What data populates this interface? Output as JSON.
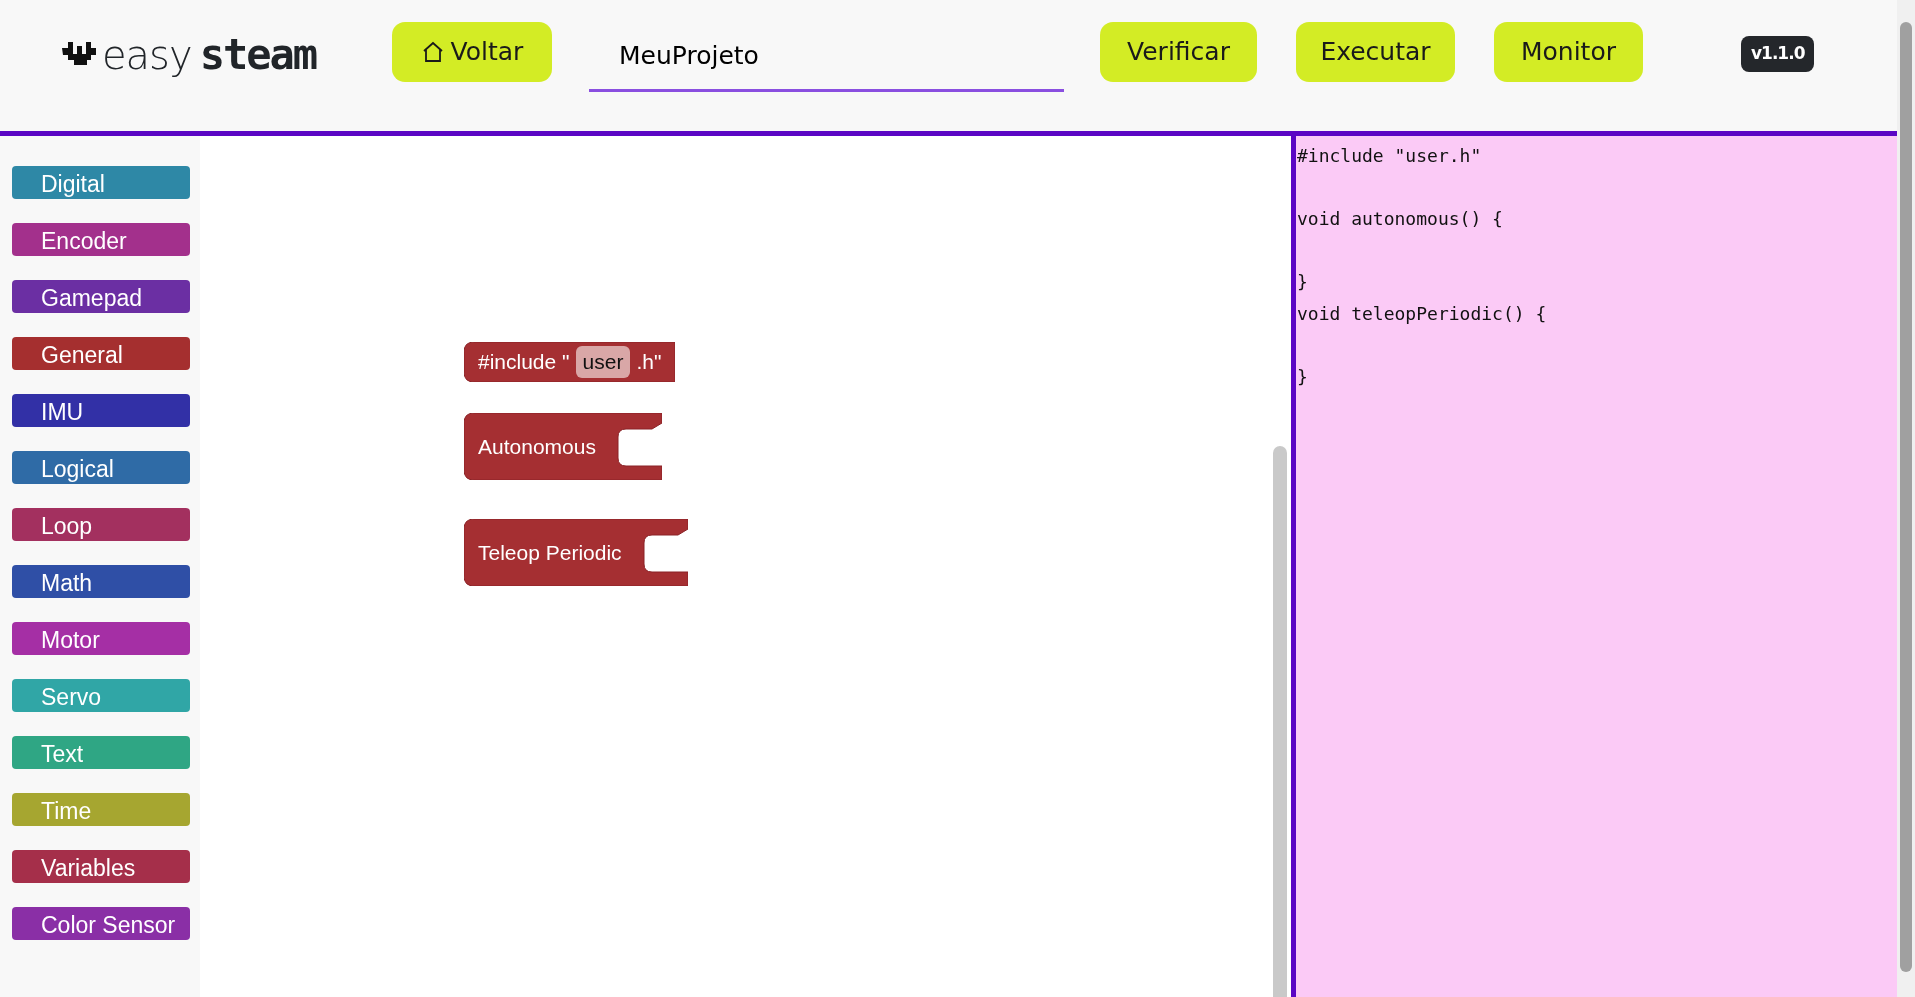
{
  "logo": {
    "light": "easy",
    "bold": "steam"
  },
  "header": {
    "back_button": "Voltar",
    "project_name": "MeuProjeto",
    "actions": [
      "Verificar",
      "Executar",
      "Monitor"
    ],
    "version": "v1.1.0"
  },
  "categories": [
    {
      "label": "Digital",
      "color": "#2e88a6"
    },
    {
      "label": "Encoder",
      "color": "#a3308c"
    },
    {
      "label": "Gamepad",
      "color": "#6b2fa3"
    },
    {
      "label": "General",
      "color": "#a52f2f"
    },
    {
      "label": "IMU",
      "color": "#3230a6"
    },
    {
      "label": "Logical",
      "color": "#2f6ba6"
    },
    {
      "label": "Loop",
      "color": "#a3305f"
    },
    {
      "label": "Math",
      "color": "#2f4fa6"
    },
    {
      "label": "Motor",
      "color": "#a52fa5"
    },
    {
      "label": "Servo",
      "color": "#30a6a6"
    },
    {
      "label": "Text",
      "color": "#2fa684"
    },
    {
      "label": "Time",
      "color": "#a6a630"
    },
    {
      "label": "Variables",
      "color": "#a52f4a"
    },
    {
      "label": "Color Sensor",
      "color": "#8a2fa6"
    }
  ],
  "workspace": {
    "blocks": [
      {
        "kind": "include",
        "before": "#include \"",
        "field": "user",
        "after": ".h\""
      },
      {
        "kind": "event",
        "label": "Autonomous"
      },
      {
        "kind": "event",
        "label": "Teleop Periodic"
      }
    ]
  },
  "code": "#include \"user.h\"\n\nvoid autonomous() {\n\n}\nvoid teleopPeriodic() {\n\n}"
}
